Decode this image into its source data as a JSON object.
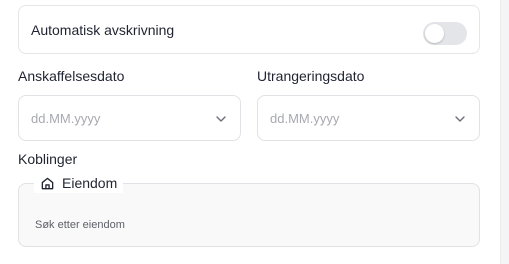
{
  "auto_depreciation": {
    "label": "Automatisk avskrivning",
    "enabled": false
  },
  "acquisition_date": {
    "label": "Anskaffelsesdato",
    "placeholder": "dd.MM.yyyy"
  },
  "disposal_date": {
    "label": "Utrangeringsdato",
    "placeholder": "dd.MM.yyyy"
  },
  "links": {
    "label": "Koblinger",
    "property": {
      "legend": "Eiendom",
      "search_placeholder": "Søk etter eiendom"
    }
  },
  "icons": {
    "property": "house-icon",
    "dropdown": "chevron-down-icon"
  }
}
